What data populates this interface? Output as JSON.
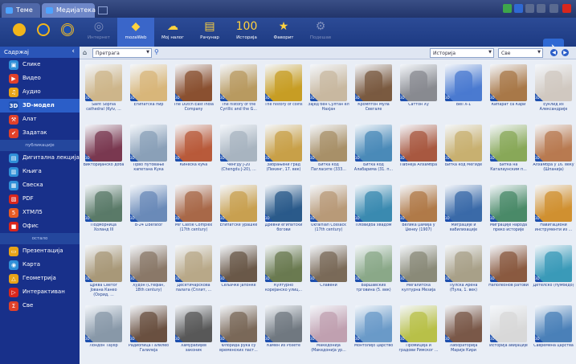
{
  "titlebar": {
    "tabs": [
      {
        "label": "Теме"
      },
      {
        "label": "Медијатека"
      }
    ]
  },
  "toolbar": {
    "buttons": [
      {
        "label": "Интернет",
        "glyph": "◎",
        "disabled": true
      },
      {
        "label": "mozaWeb",
        "glyph": "◆",
        "active": true
      },
      {
        "label": "Мој налог",
        "glyph": "☁"
      },
      {
        "label": "Рачунар",
        "glyph": "▤"
      },
      {
        "label": "Историја",
        "glyph": "100"
      },
      {
        "label": "Фаворит",
        "glyph": "★"
      },
      {
        "label": "Подешав",
        "glyph": "⚙",
        "disabled": true
      }
    ]
  },
  "sidebar": {
    "header": "Садржај",
    "groups": [
      {
        "items": [
          {
            "label": "Слике",
            "icon": "image-icon",
            "color": "#2f8fd8",
            "glyph": "▣"
          },
          {
            "label": "Видео",
            "icon": "video-icon",
            "color": "#e0412a",
            "glyph": "▶"
          },
          {
            "label": "Аудио",
            "icon": "music-icon",
            "color": "#e8a418",
            "glyph": "♫"
          },
          {
            "label": "3D-модел",
            "icon": "3d-icon",
            "color": "#1d4fae",
            "glyph": "3D",
            "active": true
          },
          {
            "label": "Алат",
            "icon": "tool-icon",
            "color": "#e0412a",
            "glyph": "⚒"
          },
          {
            "label": "Задатак",
            "icon": "task-icon",
            "color": "#e0412a",
            "glyph": "✔"
          }
        ]
      },
      {
        "title": "публикације",
        "items": [
          {
            "label": "Дигитална лекција",
            "icon": "lesson-icon",
            "color": "#2f8fd8",
            "glyph": "▤"
          },
          {
            "label": "Књига",
            "icon": "book-icon",
            "color": "#2f8fd8",
            "glyph": "▥"
          },
          {
            "label": "Свеска",
            "icon": "notebook-icon",
            "color": "#2f8fd8",
            "glyph": "▦"
          },
          {
            "label": "PDF",
            "icon": "pdf-icon",
            "color": "#d9261c",
            "glyph": "▧"
          },
          {
            "label": "ХТМЛ5",
            "icon": "html5-icon",
            "color": "#e55b24",
            "glyph": "5"
          },
          {
            "label": "Офис",
            "icon": "office-icon",
            "color": "#d9261c",
            "glyph": "■"
          }
        ]
      },
      {
        "title": "остало",
        "items": [
          {
            "label": "Презентација",
            "icon": "presentation-icon",
            "color": "#e8a418",
            "glyph": "▭"
          },
          {
            "label": "Карта",
            "icon": "map-icon",
            "color": "#2f8fd8",
            "glyph": "◉"
          },
          {
            "label": "Геометрија",
            "icon": "geometry-icon",
            "color": "#e8a418",
            "glyph": "△"
          },
          {
            "label": "Интерактиван",
            "icon": "interactive-icon",
            "color": "#d9261c",
            "glyph": "▷"
          },
          {
            "label": "Све",
            "icon": "all-icon",
            "color": "#e0412a",
            "glyph": "Σ"
          }
        ]
      }
    ]
  },
  "filterbar": {
    "search_value": "Претрага",
    "subject": "Историја",
    "grade": "Све"
  },
  "grid": {
    "badge": "3D",
    "tiles": [
      {
        "caption": "Saint Sophia cathedral (Kyiv, ...",
        "color": "#cdb58a"
      },
      {
        "caption": "Египатска пир",
        "color": "#d8b67a"
      },
      {
        "caption": "The Dutch East India Company",
        "color": "#8a5030"
      },
      {
        "caption": "The history of the Cyrillic and the G...",
        "color": "#b89a60"
      },
      {
        "caption": "The history of coins",
        "color": "#c79d24"
      },
      {
        "caption": "Зајед бен Султан ел Нахјан",
        "color": "#c8b8a0"
      },
      {
        "caption": "Кромптон Мула Свегале",
        "color": "#7a5a40"
      },
      {
        "caption": "Саттон Ху",
        "color": "#888a90"
      },
      {
        "caption": "Bell X-1",
        "color": "#4a7ad0"
      },
      {
        "caption": "Кипарат са Кари",
        "color": "#a87848"
      },
      {
        "caption": "Еуклид из Александрије",
        "color": "#d0c8c0"
      },
      {
        "caption": "Викторијанско доба",
        "color": "#7a3850"
      },
      {
        "caption": "Прво путовање капетана Кука",
        "color": "#8aa0b8"
      },
      {
        "caption": "Кинеска кућа",
        "color": "#b85a3a"
      },
      {
        "caption": "Ченгду J-20 (Chengdu J-20), ...",
        "color": "#a8b4c0"
      },
      {
        "caption": "Забрањени град (Пекинг, 17. век)",
        "color": "#c8a048"
      },
      {
        "caption": "Битка код Пагласите (333...",
        "color": "#a89068"
      },
      {
        "caption": "Битка код Алабарима (31. п...",
        "color": "#4a8ab8"
      },
      {
        "caption": "Пабнеја Алхамбра",
        "color": "#a85840"
      },
      {
        "caption": "Битка код Мегиде",
        "color": "#c8b070"
      },
      {
        "caption": "Битка на Каталаунским п...",
        "color": "#88a858"
      },
      {
        "caption": "Алхамбра у 16. веку (Шпанија)",
        "color": "#b87a50"
      },
      {
        "caption": "Подморница Холанд III",
        "color": "#5a7a68"
      },
      {
        "caption": "B-24 Liberator",
        "color": "#6a8ab8"
      },
      {
        "caption": "Mir Castle Complex (17th century)",
        "color": "#a86848"
      },
      {
        "caption": "Египатске урашке",
        "color": "#c8a050"
      },
      {
        "caption": "Древни египатски богови",
        "color": "#2a5a8a"
      },
      {
        "caption": "Ukrainian Cossack (17th century)",
        "color": "#b89a78"
      },
      {
        "caption": "Пловидба хвадом",
        "color": "#3a8ab0"
      },
      {
        "caption": "Велика џамија у Џенеу (1907)",
        "color": "#b07a48"
      },
      {
        "caption": "Миграције и вабилизације",
        "color": "#3a6aa8"
      },
      {
        "caption": "Миграције народа преко историје",
        "color": "#4a8a68"
      },
      {
        "caption": "Навигациони инструменти из ...",
        "color": "#d09030"
      },
      {
        "caption": "Црква Светог Јована Канео (Охрид, ...",
        "color": "#a89878"
      },
      {
        "caption": "Худон (Стефан, 18th century)",
        "color": "#8a7868"
      },
      {
        "caption": "Десетичарскова палата (Сплит, ...",
        "color": "#b8a888"
      },
      {
        "caption": "Сељачке јапонке",
        "color": "#6a5848"
      },
      {
        "caption": "Културно корејанско улиц...",
        "color": "#6a7a50"
      },
      {
        "caption": "Славени",
        "color": "#7a6a58"
      },
      {
        "caption": "Варшавских трговина (5. век)",
        "color": "#8aa888"
      },
      {
        "caption": "Мегалитска културна Мезија",
        "color": "#8a8a78"
      },
      {
        "caption": "Пулска Арена (Пула, 1. век)",
        "color": "#a8a088"
      },
      {
        "caption": "Наполеонов ратови",
        "color": "#8a5a40"
      },
      {
        "caption": "Детелско (пумбедо)",
        "color": "#3a9ab8"
      },
      {
        "caption": "Лондон Тауер",
        "color": "#8898a8"
      },
      {
        "caption": "Радиопица Галилео Галилеја",
        "color": "#6a5040"
      },
      {
        "caption": "Хамурабијев законик",
        "color": "#585858"
      },
      {
        "caption": "Флорида рука су временских паст...",
        "color": "#7a6858"
      },
      {
        "caption": "Камен из Розете",
        "color": "#707880"
      },
      {
        "caption": "Македонија (Македонија ур...",
        "color": "#c0a0b0"
      },
      {
        "caption": "Монтолиjo царство",
        "color": "#6a9ac8"
      },
      {
        "caption": "Промиција и градови Римског ...",
        "color": "#b8c048"
      },
      {
        "caption": "Лабораторија Марије Кири",
        "color": "#7a5848"
      },
      {
        "caption": "Историја авијације",
        "color": "#d8d8d8"
      },
      {
        "caption": "Савремена царства",
        "color": "#4a80b8"
      }
    ]
  }
}
